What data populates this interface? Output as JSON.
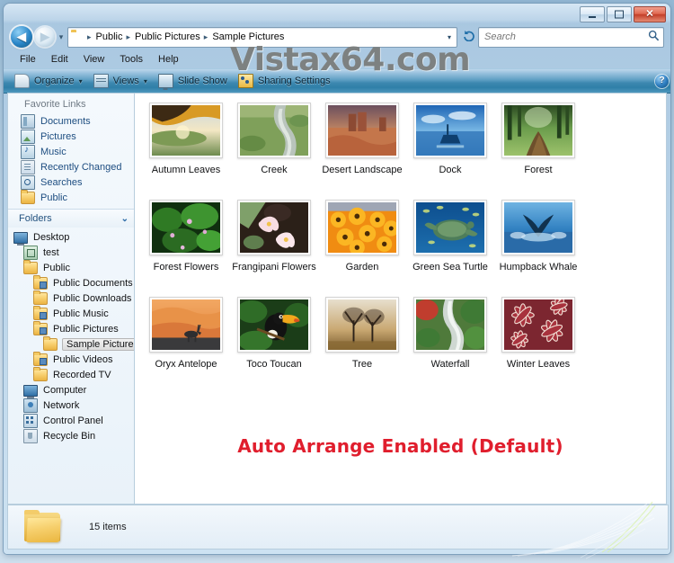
{
  "window": {
    "minimize_label": "–",
    "maximize_label": "□",
    "close_label": "✕"
  },
  "address_bar": {
    "back_label": "◀",
    "forward_label": "▶",
    "history_label": "▾",
    "breadcrumbs": [
      "Public",
      "Public Pictures",
      "Sample Pictures"
    ],
    "separator": "▸",
    "dropdown_caret": "▾",
    "refresh_label": "↻"
  },
  "search": {
    "placeholder": "Search",
    "value": "",
    "icon": "🔍"
  },
  "menu": {
    "items": [
      "File",
      "Edit",
      "View",
      "Tools",
      "Help"
    ]
  },
  "toolbar": {
    "organize_label": "Organize",
    "views_label": "Views",
    "slideshow_label": "Slide Show",
    "sharing_label": "Sharing Settings",
    "caret": "▾",
    "help_label": "?"
  },
  "watermark": {
    "text": "Vistax64.com"
  },
  "sidebar": {
    "favorites_header": "Favorite Links",
    "favorites": [
      {
        "label": "Documents",
        "icon": "documents-icon"
      },
      {
        "label": "Pictures",
        "icon": "pictures-icon"
      },
      {
        "label": "Music",
        "icon": "music-icon"
      },
      {
        "label": "Recently Changed",
        "icon": "recently-changed-icon"
      },
      {
        "label": "Searches",
        "icon": "searches-icon"
      },
      {
        "label": "Public",
        "icon": "folder-icon"
      }
    ],
    "folders_header": "Folders",
    "folders_chevron": "⌄",
    "tree": [
      {
        "label": "Desktop",
        "icon": "desktop-icon",
        "indent": 0,
        "selected": false
      },
      {
        "label": "test",
        "icon": "test-icon",
        "indent": 1,
        "selected": false
      },
      {
        "label": "Public",
        "icon": "folder-icon",
        "indent": 1,
        "selected": false
      },
      {
        "label": "Public Documents",
        "icon": "folder-doc-icon",
        "indent": 2,
        "selected": false
      },
      {
        "label": "Public Downloads",
        "icon": "folder-icon",
        "indent": 2,
        "selected": false
      },
      {
        "label": "Public Music",
        "icon": "folder-music-icon",
        "indent": 2,
        "selected": false
      },
      {
        "label": "Public Pictures",
        "icon": "folder-pictures-icon",
        "indent": 2,
        "selected": false
      },
      {
        "label": "Sample Pictures",
        "icon": "folder-icon",
        "indent": 3,
        "selected": true
      },
      {
        "label": "Public Videos",
        "icon": "folder-video-icon",
        "indent": 2,
        "selected": false
      },
      {
        "label": "Recorded TV",
        "icon": "folder-icon",
        "indent": 2,
        "selected": false
      },
      {
        "label": "Computer",
        "icon": "computer-icon",
        "indent": 1,
        "selected": false
      },
      {
        "label": "Network",
        "icon": "network-icon",
        "indent": 1,
        "selected": false
      },
      {
        "label": "Control Panel",
        "icon": "control-panel-icon",
        "indent": 1,
        "selected": false
      },
      {
        "label": "Recycle Bin",
        "icon": "recycle-bin-icon",
        "indent": 1,
        "selected": false
      }
    ]
  },
  "content": {
    "items": [
      {
        "label": "Autumn Leaves"
      },
      {
        "label": "Creek"
      },
      {
        "label": "Desert Landscape"
      },
      {
        "label": "Dock"
      },
      {
        "label": "Forest"
      },
      {
        "label": "Forest Flowers"
      },
      {
        "label": "Frangipani Flowers"
      },
      {
        "label": "Garden"
      },
      {
        "label": "Green Sea Turtle"
      },
      {
        "label": "Humpback Whale"
      },
      {
        "label": "Oryx Antelope"
      },
      {
        "label": "Toco Toucan"
      },
      {
        "label": "Tree"
      },
      {
        "label": "Waterfall"
      },
      {
        "label": "Winter Leaves"
      }
    ],
    "annotation": "Auto Arrange Enabled (Default)",
    "annotation_color": "#e01e2d"
  },
  "status": {
    "item_count": "15 items"
  }
}
